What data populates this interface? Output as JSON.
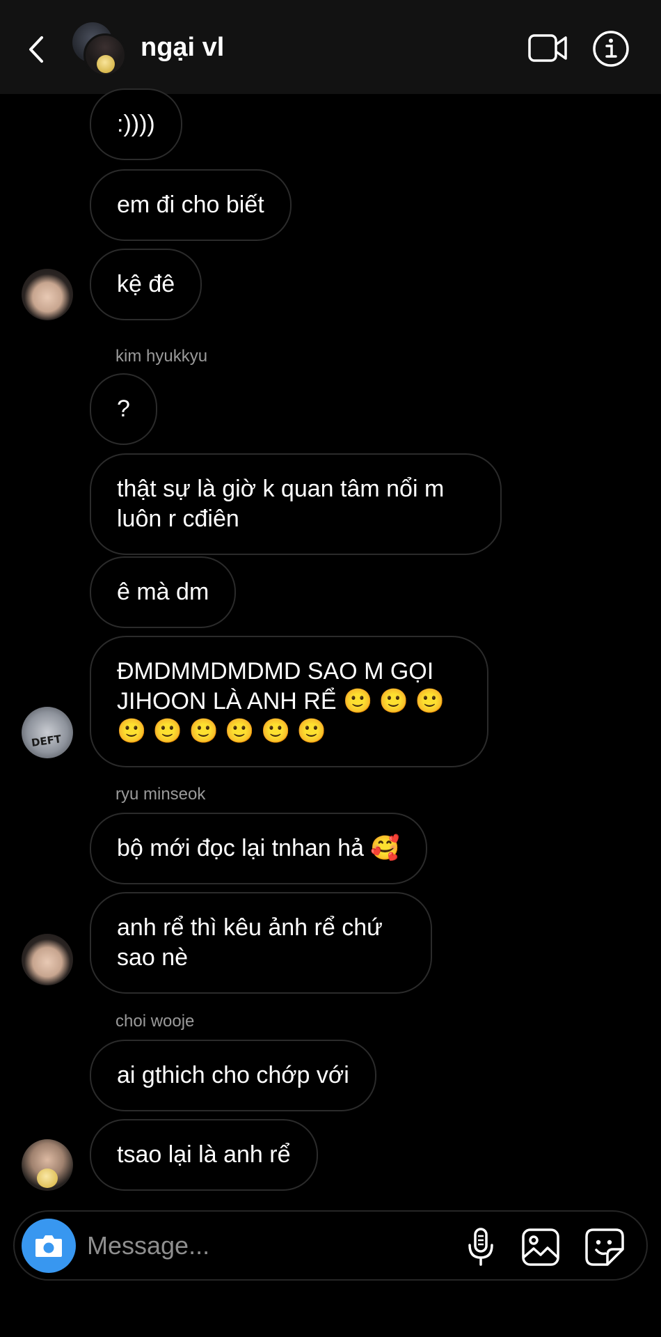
{
  "header": {
    "title": "ngại vl",
    "back_icon": "chevron-left-icon",
    "video_icon": "video-camera-icon",
    "info_icon": "info-icon"
  },
  "messages": [
    {
      "text": ":))))"
    },
    {
      "text": "em đi cho biết"
    },
    {
      "text": "kệ đê"
    },
    {
      "sender": "kim hyukkyu"
    },
    {
      "text": "?"
    },
    {
      "line1": "thật sự là giờ k quan tâm nổi m",
      "line2": "luôn r cđiên"
    },
    {
      "text": "ê mà dm"
    },
    {
      "line1": "ĐMDMMDMDMD SAO M GỌI",
      "line2": "JIHOON LÀ ANH RỂ 🙂 🙂 🙂",
      "line3": "🙂 🙂 🙂 🙂 🙂 🙂"
    },
    {
      "sender": "ryu minseok"
    },
    {
      "text": "bộ mới đọc lại tnhan hả 🥰"
    },
    {
      "line1": "anh rể thì kêu ảnh rể chứ",
      "line2": "sao nè"
    },
    {
      "sender": "choi wooje"
    },
    {
      "text": "ai gthich cho chớp với"
    },
    {
      "text": "tsao lại là anh rể"
    }
  ],
  "avatars": {
    "badge_text": "DEFT"
  },
  "composer": {
    "placeholder": "Message...",
    "camera_icon": "camera-icon",
    "mic_icon": "microphone-icon",
    "gallery_icon": "gallery-icon",
    "sticker_icon": "sticker-icon"
  },
  "colors": {
    "background": "#000000",
    "header": "#121212",
    "bubble_border": "#2b2b2b",
    "camera_button": "#3897f0",
    "sender_label": "#9a9a9a"
  }
}
